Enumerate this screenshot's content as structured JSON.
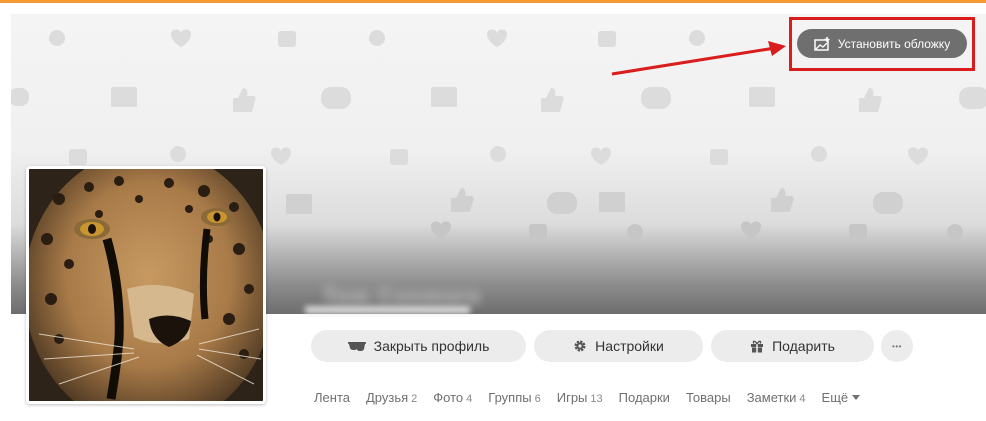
{
  "cover": {
    "set_cover_label": "Установить обложку",
    "highlight_color": "#d91c1c"
  },
  "profile": {
    "avatar_alt": "cheetah"
  },
  "actions": {
    "close_profile_label": "Закрыть профиль",
    "settings_label": "Настройки",
    "gift_label": "Подарить",
    "more_label": "•••"
  },
  "tabs": [
    {
      "label": "Лента",
      "count": ""
    },
    {
      "label": "Друзья",
      "count": "2"
    },
    {
      "label": "Фото",
      "count": "4"
    },
    {
      "label": "Группы",
      "count": "6"
    },
    {
      "label": "Игры",
      "count": "13"
    },
    {
      "label": "Подарки",
      "count": ""
    },
    {
      "label": "Товары",
      "count": ""
    },
    {
      "label": "Заметки",
      "count": "4"
    },
    {
      "label": "Ещё",
      "count": ""
    }
  ],
  "colors": {
    "accent": "#f59a32",
    "button_bg": "#ececec",
    "cover_button_bg": "#6f6f6f"
  }
}
